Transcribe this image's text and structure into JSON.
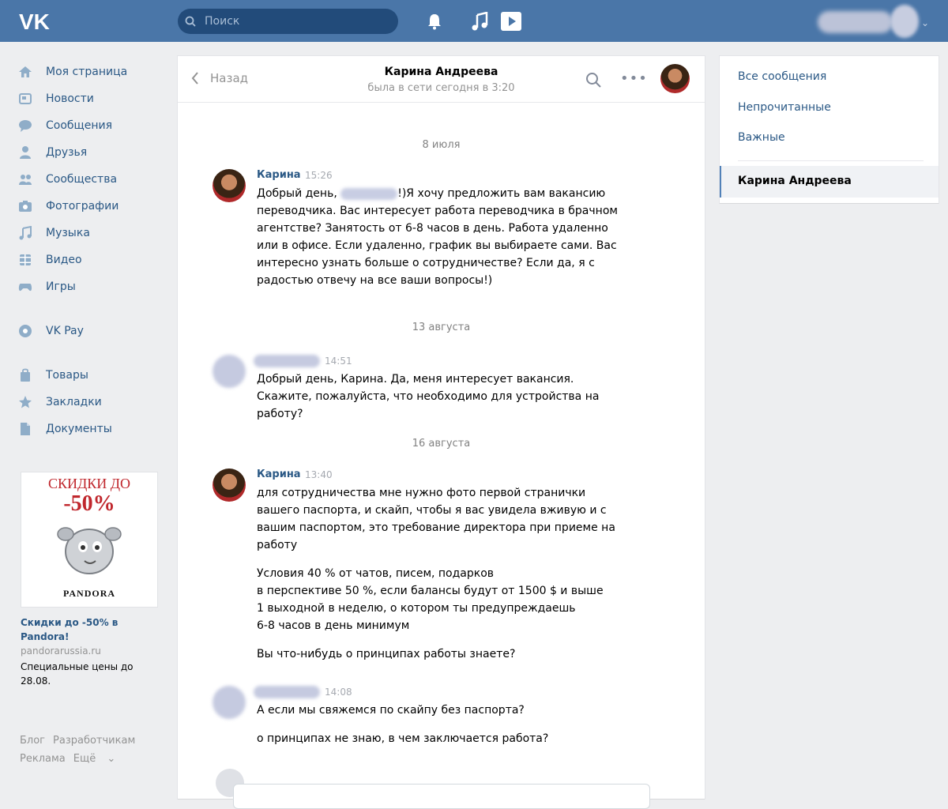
{
  "topbar": {
    "search_placeholder": "Поиск"
  },
  "nav": {
    "items": [
      {
        "label": "Моя страница",
        "icon": "home-icon"
      },
      {
        "label": "Новости",
        "icon": "news-icon"
      },
      {
        "label": "Сообщения",
        "icon": "messages-icon"
      },
      {
        "label": "Друзья",
        "icon": "friends-icon"
      },
      {
        "label": "Сообщества",
        "icon": "groups-icon"
      },
      {
        "label": "Фотографии",
        "icon": "photos-icon"
      },
      {
        "label": "Музыка",
        "icon": "music-icon"
      },
      {
        "label": "Видео",
        "icon": "video-icon"
      },
      {
        "label": "Игры",
        "icon": "games-icon"
      },
      {
        "label": "VK Pay",
        "icon": "vkpay-icon"
      },
      {
        "label": "Товары",
        "icon": "market-icon"
      },
      {
        "label": "Закладки",
        "icon": "bookmarks-icon"
      },
      {
        "label": "Документы",
        "icon": "documents-icon"
      }
    ]
  },
  "ad": {
    "image_headline": "СКИДКИ ДО",
    "image_percent": "-50%",
    "image_brand": "PANDORA",
    "title": "Скидки до -50% в Pandora!",
    "domain": "pandorarussia.ru",
    "text": "Специальные цены до 28.08."
  },
  "footer": {
    "blog": "Блог",
    "developers": "Разработчикам",
    "ads": "Реклама",
    "more": "Ещё"
  },
  "chat": {
    "back_label": "Назад",
    "peer_name": "Карина Андреева",
    "peer_status": "была в сети сегодня в 3:20",
    "dates": [
      "8 июля",
      "13 августа",
      "16 августа"
    ],
    "messages": [
      {
        "author": "Карина",
        "time": "15:26",
        "lines": [
          "Добрый день,",
          "!)Я хочу предложить вам вакансию переводчика. Вас интересует работа переводчика в брачном агентстве? Занятость от 6-8 часов в день. Работа удаленно или в офисе. Если удаленно, график вы выбираете сами. Вас интересно узнать больше о сотрудничестве? Если да, я с радостью отвечу на все ваши вопросы!)"
        ]
      },
      {
        "author": "",
        "time": "14:51",
        "lines": [
          "Добрый день, Карина. Да, меня интересует вакансия. Скажите, пожалуйста, что необходимо для устройства на работу?"
        ]
      },
      {
        "author": "Карина",
        "time": "13:40",
        "lines": [
          "для сотрудничества мне нужно фото первой странички вашего паспорта, и скайп, чтобы я вас увидела вживую и с вашим паспортом, это требование директора при приеме на работу",
          "Условия 40 % от чатов, писем, подарков",
          "в перспективе 50 %, если балансы будут от 1500 $ и выше",
          "1 выходной в неделю, о котором ты предупреждаешь",
          "6-8 часов в день минимум",
          "Вы что-нибудь о принципах работы знаете?"
        ]
      },
      {
        "author": "",
        "time": "14:08",
        "lines": [
          "А если мы свяжемся по скайпу без паспорта?",
          "о принципах не знаю, в чем заключается работа?"
        ]
      }
    ]
  },
  "right": {
    "all": "Все сообщения",
    "unread": "Непрочитанные",
    "important": "Важные",
    "active_dialog": "Карина Андреева"
  }
}
